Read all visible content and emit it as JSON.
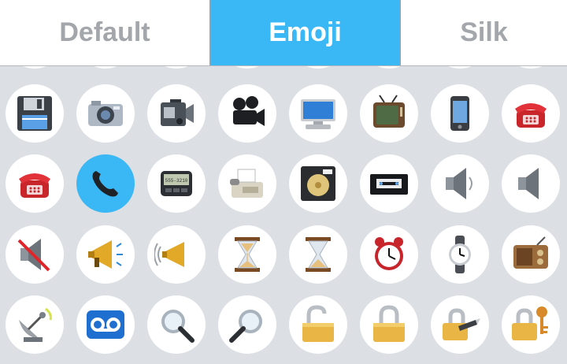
{
  "tabs": [
    {
      "label": "Default",
      "active": false
    },
    {
      "label": "Emoji",
      "active": true
    },
    {
      "label": "Silk",
      "active": false
    }
  ],
  "colors": {
    "active_tab": "#3ab8f6",
    "selected_cell": "#3ab8f6",
    "grid_background": "#dcdfe3",
    "cell_background": "#ffffff"
  },
  "emoji_rows": [
    [
      "floppy-disk",
      "camera",
      "video-camera",
      "movie-camera",
      "computer",
      "television",
      "mobile-phone",
      "red-telephone"
    ],
    [
      "red-telephone",
      "telephone-receiver",
      "pager",
      "fax-machine",
      "minidisc",
      "videocassette",
      "speaker",
      "speaker-low"
    ],
    [
      "speaker-muted",
      "loudspeaker",
      "megaphone",
      "hourglass-flowing",
      "hourglass",
      "alarm-clock",
      "wristwatch",
      "radio"
    ],
    [
      "satellite-antenna",
      "voicemail",
      "magnifier-left",
      "magnifier-right",
      "unlocked",
      "locked",
      "lock-with-pen",
      "lock-with-key"
    ]
  ],
  "selected": {
    "row": 1,
    "col": 1
  }
}
